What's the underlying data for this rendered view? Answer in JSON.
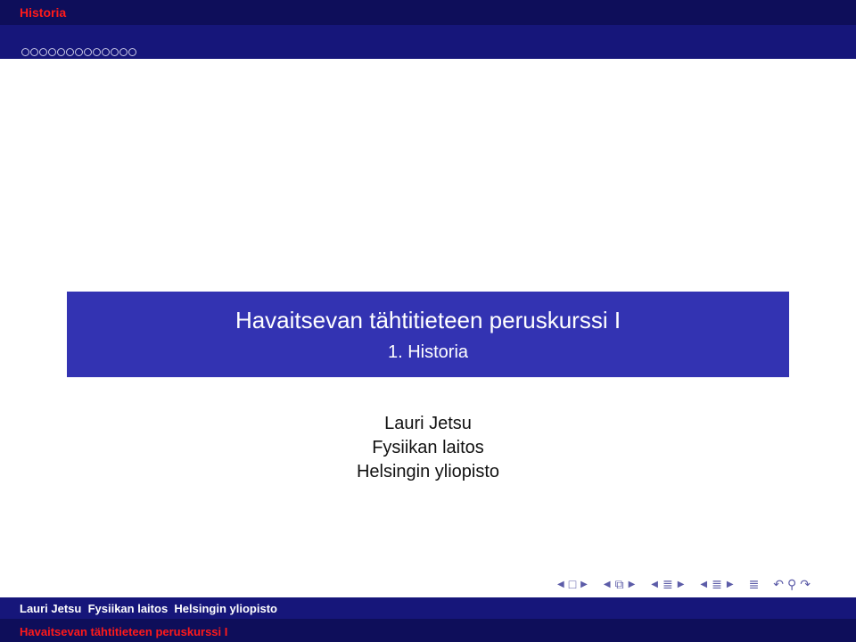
{
  "header": {
    "section": "Historia",
    "nav_dot_count": 13
  },
  "title_block": {
    "title": "Havaitsevan tähtitieteen peruskurssi I",
    "subtitle": "1. Historia"
  },
  "author_block": {
    "author": "Lauri Jetsu",
    "department": "Fysiikan laitos",
    "university": "Helsingin yliopisto"
  },
  "footer": {
    "authors_line": "Lauri Jetsu  Fysiikan laitos  Helsingin yliopisto",
    "title_line": "Havaitsevan tähtitieteen peruskurssi I"
  },
  "nav_icons": [
    "nav-frame-prev-icon",
    "frame-icon",
    "nav-frame-next-icon",
    "nav-subsection-prev-icon",
    "subsection-icon",
    "nav-subsection-next-icon",
    "nav-section-prev-icon",
    "section-icon",
    "nav-section-next-icon",
    "nav-doc-prev-icon",
    "document-icon",
    "nav-doc-next-icon",
    "appendix-icon",
    "search-back-icon",
    "search-icon",
    "search-forward-icon"
  ],
  "colors": {
    "header_dark": "#0e0e5a",
    "header_light": "#16167a",
    "title_box": "#3333b2",
    "accent_red": "#ff1a1a",
    "nav_symbol": "#5c5ca8"
  }
}
